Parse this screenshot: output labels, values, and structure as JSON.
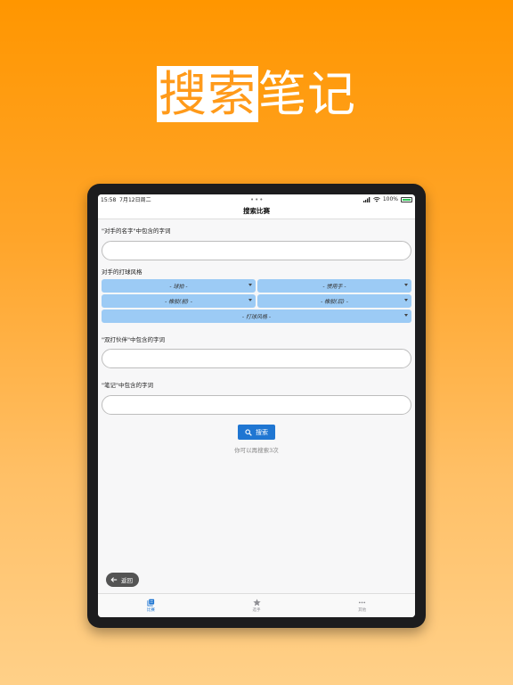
{
  "headline": {
    "highlight": "搜索",
    "rest": "笔记"
  },
  "status": {
    "time": "15:58",
    "date": "7月12日周二",
    "dots": "•••",
    "battery": "100%"
  },
  "nav": {
    "title": "搜索比赛"
  },
  "form": {
    "opponent_label": "\"对手的名字\"中包含的字词",
    "opponent_value": "",
    "style_label": "对手的打球风格",
    "dropdowns": {
      "grip": "- 球拍 -",
      "hand": "- 惯用手 -",
      "rubber_front": "- 橡胶(前) -",
      "rubber_back": "- 橡胶(后) -",
      "play_style": "- 打球风格 -"
    },
    "partner_label": "\"双打伙伴\"中包含的字词",
    "partner_value": "",
    "note_label": "\"笔记\"中包含的字词",
    "note_value": "",
    "search_label": "搜索",
    "remaining": "你可以再搜索3次"
  },
  "back": {
    "label": "返回"
  },
  "tabs": [
    {
      "label": "比赛",
      "icon": "library-icon",
      "active": true
    },
    {
      "label": "选手",
      "icon": "star-icon",
      "active": false
    },
    {
      "label": "其他",
      "icon": "more-icon",
      "active": false
    }
  ],
  "colors": {
    "accent": "#1f76d2",
    "dropdown": "#9ccbf5",
    "background_top": "#ff9600"
  }
}
